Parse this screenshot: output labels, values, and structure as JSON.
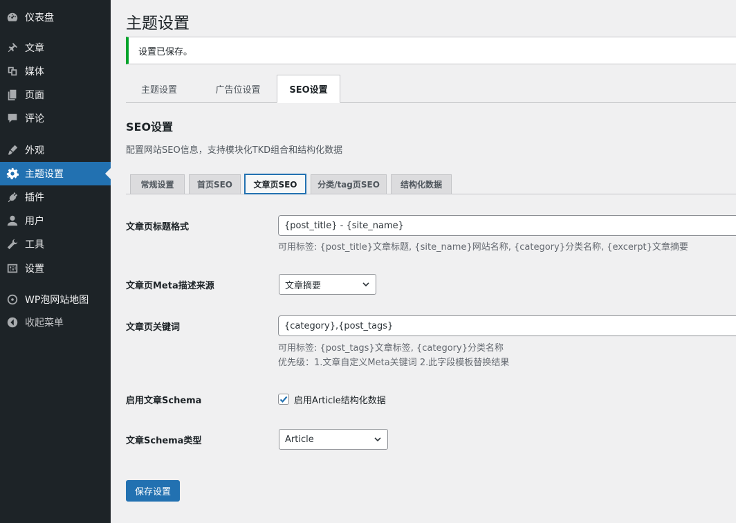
{
  "sidebar": {
    "items": [
      {
        "label": "仪表盘",
        "icon": "dashboard-icon"
      },
      {
        "label": "文章",
        "icon": "pin-icon"
      },
      {
        "label": "媒体",
        "icon": "media-icon"
      },
      {
        "label": "页面",
        "icon": "page-icon"
      },
      {
        "label": "评论",
        "icon": "comment-icon"
      },
      {
        "label": "外观",
        "icon": "brush-icon"
      },
      {
        "label": "主题设置",
        "icon": "gear-icon",
        "active": true
      },
      {
        "label": "插件",
        "icon": "plugin-icon"
      },
      {
        "label": "用户",
        "icon": "user-icon"
      },
      {
        "label": "工具",
        "icon": "wrench-icon"
      },
      {
        "label": "设置",
        "icon": "settings-icon"
      },
      {
        "label": "WP泡网站地图",
        "icon": "sitemap-icon"
      },
      {
        "label": "收起菜单",
        "icon": "collapse-icon"
      }
    ]
  },
  "page": {
    "title": "主题设置",
    "notice": "设置已保存。"
  },
  "nav_tabs": [
    "主题设置",
    "广告位设置",
    "SEO设置"
  ],
  "section": {
    "title": "SEO设置",
    "desc": "配置网站SEO信息，支持模块化TKD组合和结构化数据"
  },
  "sub_tabs": [
    "常规设置",
    "首页SEO",
    "文章页SEO",
    "分类/tag页SEO",
    "结构化数据"
  ],
  "fields": {
    "title_format": {
      "label": "文章页标题格式",
      "value": "{post_title} - {site_name}",
      "hint": "可用标签: {post_title}文章标题, {site_name}网站名称, {category}分类名称, {excerpt}文章摘要"
    },
    "meta_source": {
      "label": "文章页Meta描述来源",
      "value": "文章摘要"
    },
    "keywords": {
      "label": "文章页关键词",
      "value": "{category},{post_tags}",
      "hint1": "可用标签: {post_tags}文章标签, {category}分类名称",
      "hint2": "优先级：1.文章自定义Meta关键词 2.此字段模板替换结果"
    },
    "schema_enable": {
      "label": "启用文章Schema",
      "checkbox_label": "启用Article结构化数据",
      "checked": true
    },
    "schema_type": {
      "label": "文章Schema类型",
      "value": "Article"
    }
  },
  "buttons": {
    "save": "保存设置"
  },
  "colors": {
    "sidebar_bg": "#1d2327",
    "accent": "#2271b1",
    "success": "#00a32a"
  }
}
